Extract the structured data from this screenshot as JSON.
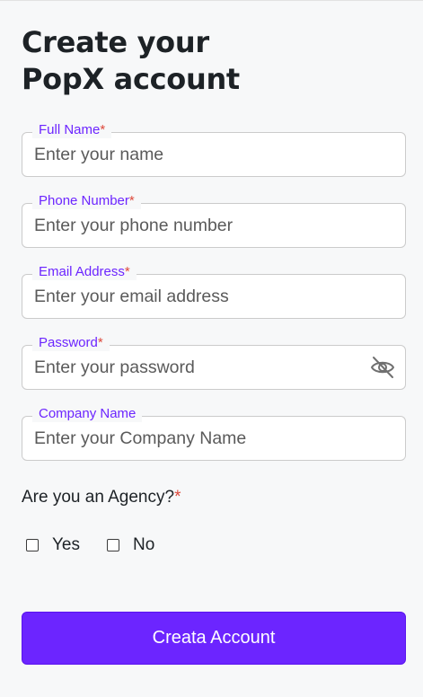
{
  "header": {
    "title": "Create your\nPopX account"
  },
  "form": {
    "fields": [
      {
        "label": "Full Name",
        "required_mark": "*",
        "placeholder": "Enter your name",
        "value": ""
      },
      {
        "label": "Phone Number",
        "required_mark": "*",
        "placeholder": "Enter your phone number",
        "value": ""
      },
      {
        "label": "Email Address",
        "required_mark": "*",
        "placeholder": "Enter your email address",
        "value": ""
      },
      {
        "label": "Password",
        "required_mark": "*",
        "placeholder": "Enter your password",
        "value": "",
        "toggle_icon": "eye-off-icon"
      },
      {
        "label": "Company Name",
        "required_mark": "",
        "placeholder": "Enter your Company Name",
        "value": ""
      }
    ],
    "agency": {
      "question": "Are you an Agency?",
      "required_mark": "*",
      "options": [
        {
          "label": "Yes",
          "checked": false
        },
        {
          "label": "No",
          "checked": false
        }
      ]
    },
    "submit_label": "Creata Account"
  },
  "colors": {
    "accent": "#6c25ff",
    "required": "#dd4a3d",
    "background": "#f7f8f9",
    "text": "#1d2226"
  }
}
